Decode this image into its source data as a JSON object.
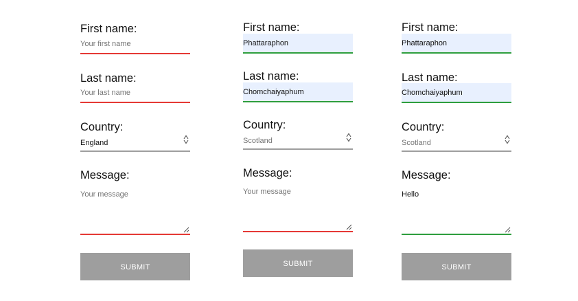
{
  "forms": [
    {
      "first_name_label": "First name:",
      "first_name_value": "",
      "first_name_placeholder": "Your first name",
      "last_name_label": "Last name:",
      "last_name_value": "",
      "last_name_placeholder": "Your last name",
      "country_label": "Country:",
      "country_value": "England",
      "message_label": "Message:",
      "message_value": "",
      "message_placeholder": "Your message",
      "submit_label": "SUBMIT"
    },
    {
      "first_name_label": "First name:",
      "first_name_value": "Phattaraphon",
      "first_name_placeholder": "",
      "last_name_label": "Last name:",
      "last_name_value": "Chomchaiyaphum",
      "last_name_placeholder": "",
      "country_label": "Country:",
      "country_value": "Scotland",
      "message_label": "Message:",
      "message_value": "",
      "message_placeholder": "Your message",
      "submit_label": "SUBMIT"
    },
    {
      "first_name_label": "First name:",
      "first_name_value": "Phattaraphon",
      "first_name_placeholder": "",
      "last_name_label": "Last name:",
      "last_name_value": "Chomchaiyaphum",
      "last_name_placeholder": "",
      "country_label": "Country:",
      "country_value": "Scotland",
      "message_label": "Message:",
      "message_value": "Hello",
      "message_placeholder": "",
      "submit_label": "SUBMIT"
    }
  ],
  "colors": {
    "error_underline": "#e53935",
    "valid_underline": "#2e9e3e",
    "neutral_underline": "#9e9e9e",
    "autofill_background": "#e8f0fe",
    "button_background": "#9e9e9e",
    "button_text": "#ffffff"
  },
  "icons": {
    "select_arrow": "updown-chevron-icon",
    "resize_handle": "resize-grip-icon"
  }
}
